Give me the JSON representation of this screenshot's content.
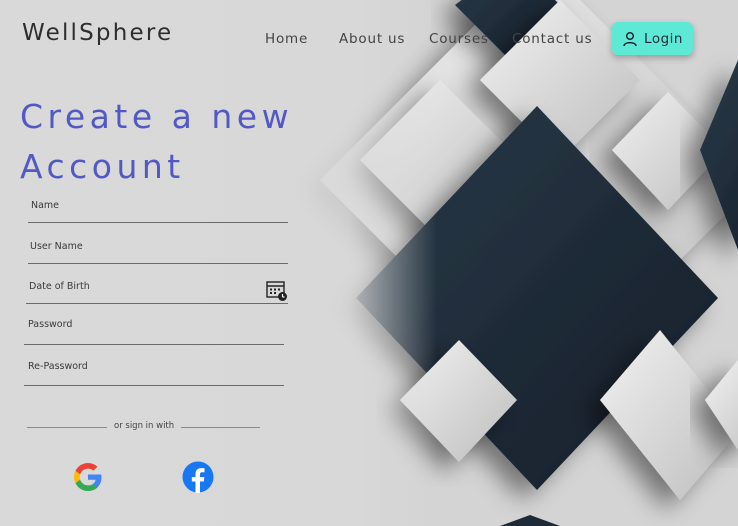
{
  "brand": {
    "logo": "WellSphere"
  },
  "nav": {
    "items": [
      "Home",
      "About us",
      "Courses",
      "Contact us"
    ],
    "login_label": "Login"
  },
  "form": {
    "title_line1": "Create a new",
    "title_line2": "Account",
    "fields": [
      {
        "label": "Name"
      },
      {
        "label": "User Name"
      },
      {
        "label": "Date of Birth"
      },
      {
        "label": "Password"
      },
      {
        "label": "Re-Password"
      }
    ],
    "divider_text": "or sign in with"
  },
  "social": [
    "google-icon",
    "facebook-icon"
  ],
  "colors": {
    "accent": "#5259c6",
    "login_button": "#5ee8d6",
    "diamond_dark": "#1e2a38",
    "diamond_light": "#d9d9d9"
  }
}
